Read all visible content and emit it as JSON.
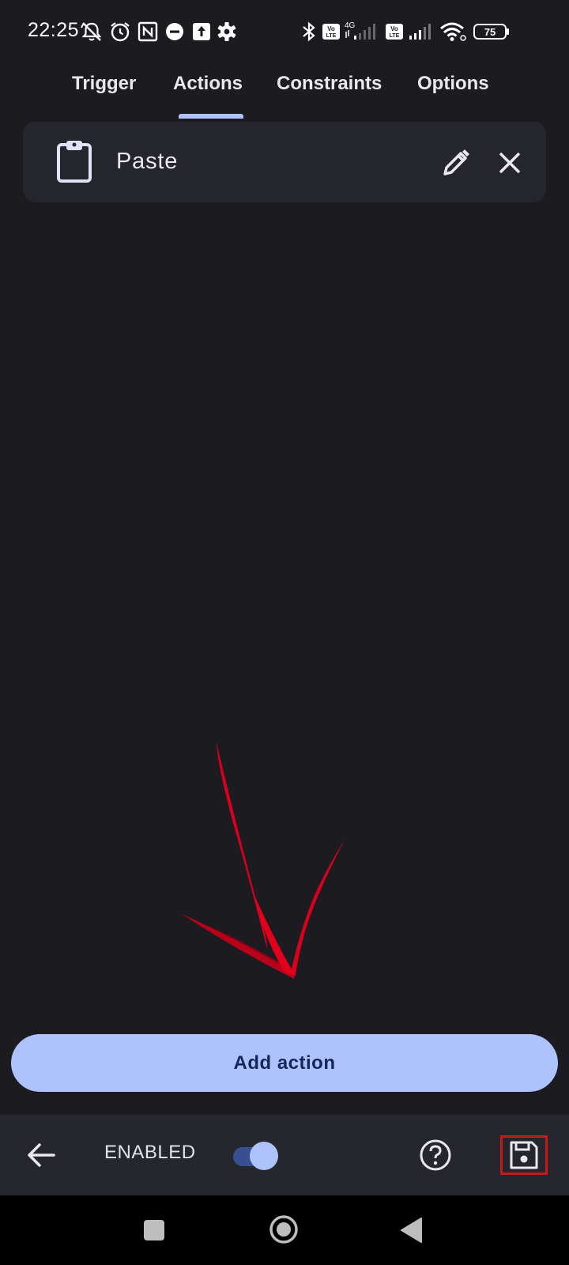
{
  "status_bar": {
    "time": "22:25",
    "left_icons": [
      "alarm-off-icon",
      "alarm-clock-icon",
      "nfc-icon",
      "circle-minus-icon",
      "upload-box-icon",
      "settings-gear-icon"
    ],
    "right_icons": [
      "bluetooth-icon",
      "volte-icon",
      "signal-4g-icon",
      "volte-icon",
      "signal-icon",
      "wifi-icon",
      "battery-icon"
    ],
    "network_type": "4G",
    "volte_label": "Vo LTE",
    "battery_level": "75"
  },
  "tabs": {
    "items": [
      {
        "label": "Trigger"
      },
      {
        "label": "Actions",
        "selected": true
      },
      {
        "label": "Constraints"
      },
      {
        "label": "Options"
      }
    ]
  },
  "actions_list": {
    "items": [
      {
        "label": "Paste",
        "icon": "clipboard-icon"
      }
    ]
  },
  "annotation": {
    "type": "red-arrow-icon",
    "color": "#d8001c"
  },
  "add_action": {
    "label": "Add action"
  },
  "bottom_bar": {
    "back_icon": "arrow-left-icon",
    "enabled_label": "ENABLED",
    "enabled": true,
    "help_icon": "help-circle-icon",
    "save_icon": "save-floppy-icon",
    "save_highlight_color": "#c41c1c"
  },
  "nav_bar": {
    "icons": [
      "recents-square-icon",
      "home-circle-icon",
      "back-triangle-icon"
    ]
  },
  "colors": {
    "background": "#1b1b20",
    "card": "#24252d",
    "accent": "#aec3fb",
    "accent_text": "#14275a",
    "bottom_bar": "#25262e"
  }
}
